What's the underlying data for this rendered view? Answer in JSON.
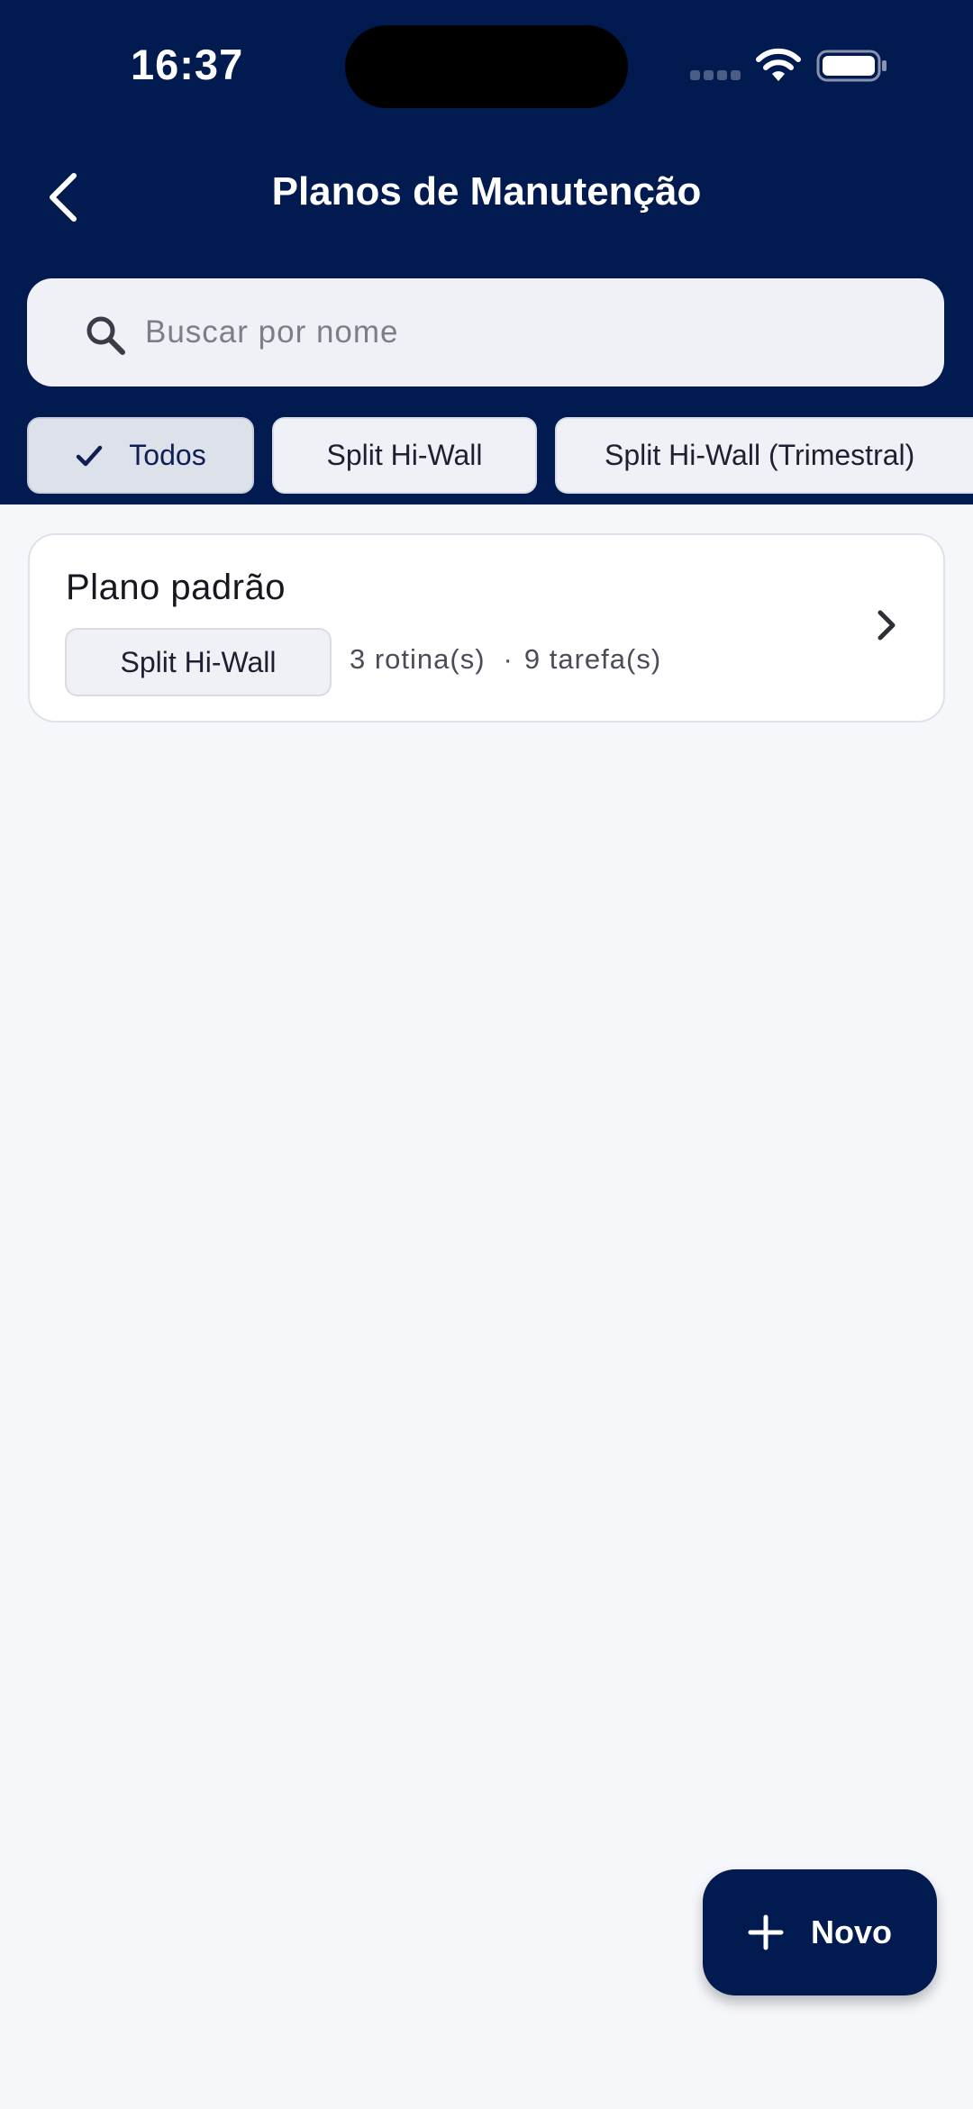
{
  "status_bar": {
    "time": "16:37"
  },
  "header": {
    "title": "Planos de Manutenção",
    "back_icon": "chevron-left-icon"
  },
  "search": {
    "placeholder": "Buscar por nome",
    "value": "",
    "icon": "search-icon"
  },
  "filters": [
    {
      "label": "Todos",
      "selected": true
    },
    {
      "label": "Split Hi-Wall",
      "selected": false
    },
    {
      "label": "Split Hi-Wall (Trimestral)",
      "selected": false
    }
  ],
  "plans": [
    {
      "name": "Plano padrão",
      "equipment": "Split Hi-Wall",
      "routines": "3 rotina(s)",
      "separator": "·",
      "tasks": "9 tarefa(s)"
    }
  ],
  "fab": {
    "label": "Novo",
    "icon": "plus-icon"
  },
  "colors": {
    "header_bg": "#011a4f",
    "page_bg": "#f6f7fb",
    "chip_bg": "#eff1f6",
    "chip_selected_bg": "#dde1ea"
  }
}
